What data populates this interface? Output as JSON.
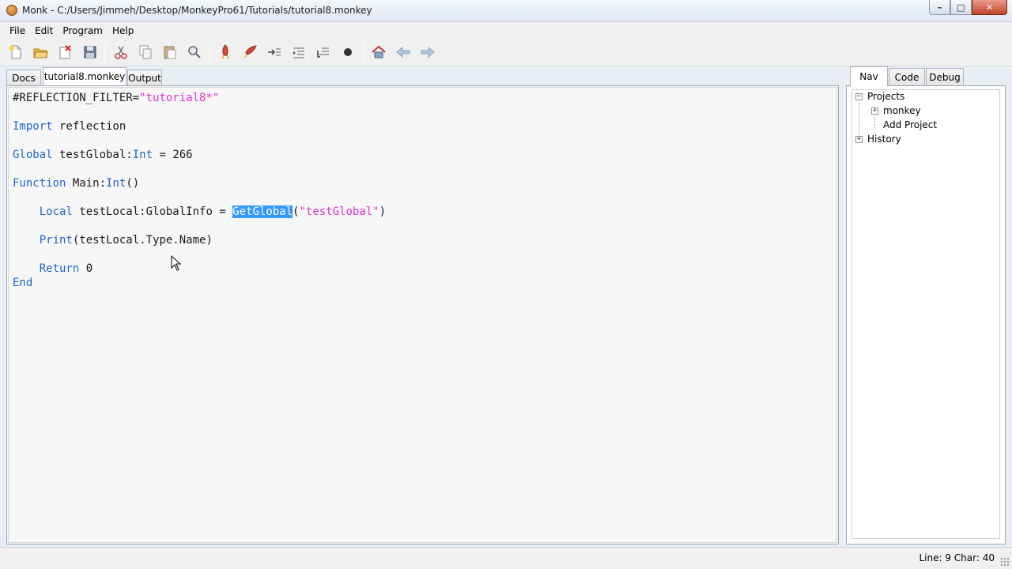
{
  "window": {
    "title": "Monk - C:/Users/Jimmeh/Desktop/MonkeyPro61/Tutorials/tutorial8.monkey",
    "minimize": "–",
    "maximize": "□",
    "close": "✕"
  },
  "menu": [
    "File",
    "Edit",
    "Program",
    "Help"
  ],
  "toolbar": {
    "icons": [
      "new-file-icon",
      "open-folder-icon",
      "close-file-icon",
      "save-icon",
      "cut-icon",
      "copy-icon",
      "paste-icon",
      "find-icon",
      "build-icon",
      "build-run-icon",
      "step-icon",
      "step-in-icon",
      "step-out-icon",
      "stop-icon",
      "home-icon",
      "back-icon",
      "forward-icon"
    ]
  },
  "editor_tabs": [
    "Docs",
    "tutorial8.monkey",
    "Output"
  ],
  "active_editor_tab": "tutorial8.monkey",
  "code": {
    "l1_a": "#REFLECTION_FILTER=",
    "l1_b": "\"tutorial8*\"",
    "l2_kw": "Import",
    "l2_rest": " reflection",
    "l3_kw": "Global",
    "l3_a": " testGlobal:",
    "l3_kw2": "Int",
    "l3_b": " = 266",
    "l4_kw": "Function",
    "l4_a": " Main:",
    "l4_kw2": "Int",
    "l4_b": "()",
    "l5_indent": "    ",
    "l5_kw": "Local",
    "l5_a": " testLocal:GlobalInfo = ",
    "l5_sel": "GetGlobal",
    "l5_b": "(",
    "l5_str": "\"testGlobal\"",
    "l5_c": ")",
    "l6_indent": "    ",
    "l6_kw": "Print",
    "l6_rest": "(testLocal.Type.Name)",
    "l7_indent": "    ",
    "l7_kw": "Return",
    "l7_rest": " 0",
    "l8_kw": "End"
  },
  "nav_tabs": [
    "Nav",
    "Code",
    "Debug"
  ],
  "active_nav_tab": "Nav",
  "nav_tree": {
    "projects": "Projects",
    "monkey": "monkey",
    "add_project": "Add Project",
    "history": "History",
    "collapse": "−",
    "expand": "+"
  },
  "status": {
    "position": "Line: 9 Char: 40"
  },
  "colors": {
    "keyword": "#2266c4",
    "string": "#e032d0",
    "selection": "#3399ff"
  }
}
